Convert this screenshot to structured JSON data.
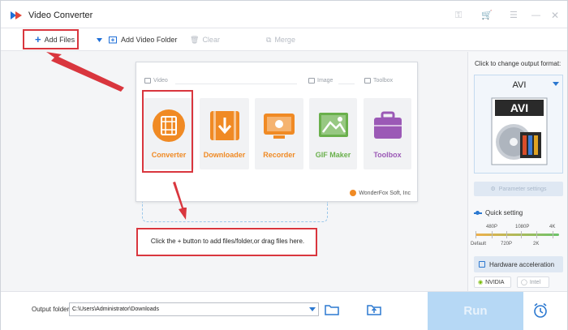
{
  "window": {
    "title": "Video Converter"
  },
  "toolbar": {
    "add_files": "Add Files",
    "add_video_folder": "Add Video Folder",
    "clear": "Clear",
    "merge": "Merge"
  },
  "card": {
    "sections": {
      "video": "Video",
      "image": "Image",
      "toolbox": "Toolbox"
    },
    "tiles": [
      {
        "label": "Converter",
        "color": "#f08a24"
      },
      {
        "label": "Downloader",
        "color": "#f08a24"
      },
      {
        "label": "Recorder",
        "color": "#f08a24"
      },
      {
        "label": "GIF Maker",
        "color": "#6ab04c"
      },
      {
        "label": "Toolbox",
        "color": "#9b59b6"
      }
    ],
    "footer": "WonderFox Soft, Inc"
  },
  "instruction": "Click the + button to add files/folder,or drag files here.",
  "right_panel": {
    "caption": "Click to change output format:",
    "format": "AVI",
    "format_art_label": "AVI",
    "parameter_settings": "Parameter settings",
    "quick_setting": "Quick setting",
    "res_top": [
      "480P",
      "1080P",
      "4K"
    ],
    "res_bottom": [
      "Default",
      "720P",
      "2K"
    ],
    "hardware_acceleration": "Hardware acceleration",
    "nvidia": "NVIDIA",
    "intel": "Intel"
  },
  "bottom": {
    "output_folder_label": "Output folder:",
    "output_folder_path": "C:\\Users\\Administrator\\Downloads",
    "run": "Run"
  },
  "colors": {
    "accent": "#2b78d0",
    "highlight": "#d9363e",
    "run_button": "#b6d8f5"
  }
}
